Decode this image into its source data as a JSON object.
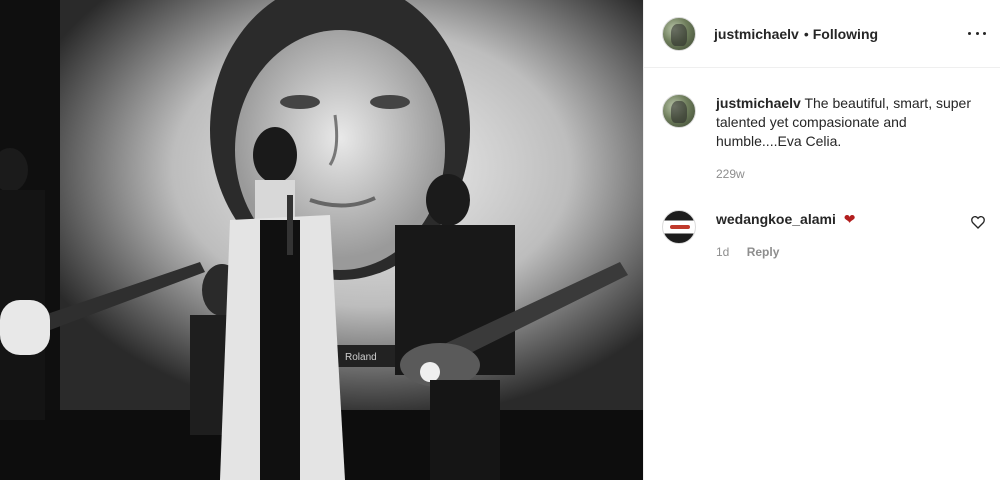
{
  "post": {
    "username": "justmichaelv",
    "separator": "•",
    "follow_status": "Following",
    "caption": "The beautiful, smart, super talented yet compasionate and humble....Eva Celia.",
    "time": "229w"
  },
  "comments": [
    {
      "username": "wedangkoe_alami",
      "text": "❤",
      "time": "1d",
      "reply_label": "Reply"
    }
  ],
  "icons": {
    "more": "more-options-icon",
    "like": "heart-outline-icon"
  }
}
